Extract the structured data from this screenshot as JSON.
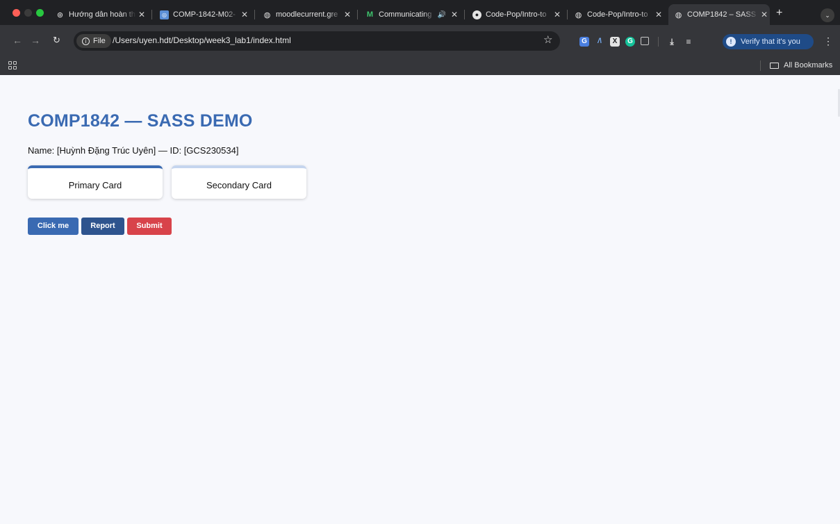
{
  "browser": {
    "tabs": [
      {
        "title": "Hướng dẫn hoàn thành",
        "icon": "openai-icon"
      },
      {
        "title": "COMP-1842-M02-",
        "icon": "moodle-icon"
      },
      {
        "title": "moodlecurrent.gre",
        "icon": "globe-icon"
      },
      {
        "title": "Communicating",
        "icon": "m-logo-icon",
        "audio": "🔊"
      },
      {
        "title": "Code-Pop/Intro-to",
        "icon": "github-icon"
      },
      {
        "title": "Code-Pop/Intro-to",
        "icon": "globe-icon"
      },
      {
        "title": "COMP1842 – SASS",
        "icon": "globe-icon",
        "active": true
      }
    ],
    "omnibox": {
      "chip_label": "File",
      "url": "/Users/uyen.hdt/Desktop/week3_lab1/index.html"
    },
    "profile_button": "Verify that it's you",
    "bookmarks": {
      "all_bookmarks": "All Bookmarks"
    }
  },
  "page": {
    "title": "COMP1842 — SASS DEMO",
    "info": "Name: [Huỳnh Đặng Trúc Uyên] — ID: [GCS230534]",
    "cards": {
      "primary": "Primary Card",
      "secondary": "Secondary Card"
    },
    "buttons": {
      "click": "Click me",
      "report": "Report",
      "submit": "Submit"
    }
  },
  "colors": {
    "primary": "#3a6ab2",
    "primary_dark": "#2e548e",
    "danger": "#d8434a",
    "secondary_accent": "#c5d5ee",
    "page_bg": "#f7f8fc"
  }
}
